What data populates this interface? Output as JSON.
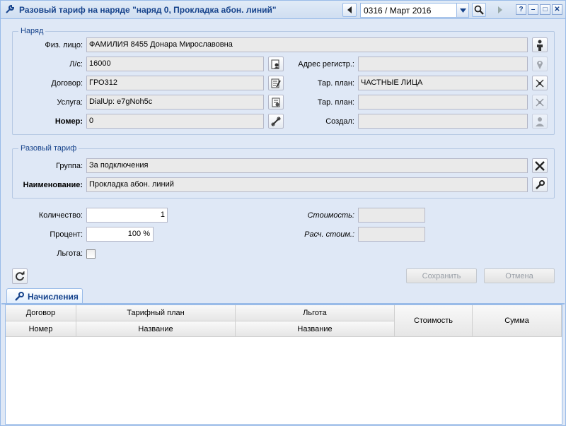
{
  "window": {
    "title": "Разовый тариф на наряде \"наряд 0, Прокладка абон. линий\"",
    "period": "0316 / Март 2016"
  },
  "naryad": {
    "legend": "Наряд",
    "fiz_lico": {
      "label": "Физ. лицо:",
      "value": "ФАМИЛИЯ 8455 Донара Мирославовна"
    },
    "ls": {
      "label": "Л/с:",
      "value": "16000"
    },
    "dogovor": {
      "label": "Договор:",
      "value": "ГРО312"
    },
    "usluga": {
      "label": "Услуга:",
      "value": "DialUp: e7gNoh5c"
    },
    "nomer": {
      "label": "Номер:",
      "value": "0"
    },
    "adres": {
      "label": "Адрес регистр.:",
      "value": ""
    },
    "tar_plan1": {
      "label": "Тар. план:",
      "value": "ЧАСТНЫЕ ЛИЦА"
    },
    "tar_plan2": {
      "label": "Тар. план:",
      "value": ""
    },
    "sozdal": {
      "label": "Создал:",
      "value": ""
    }
  },
  "razoviy": {
    "legend": "Разовый тариф",
    "gruppa": {
      "label": "Группа:",
      "value": "За подключения"
    },
    "naim": {
      "label": "Наименование:",
      "value": "Прокладка абон. линий"
    }
  },
  "extra": {
    "kolichestvo": {
      "label": "Количество:",
      "value": "1"
    },
    "procent": {
      "label": "Процент:",
      "value": "100 %"
    },
    "lgota": {
      "label": "Льгота:"
    },
    "stoimost": {
      "label": "Стоимость:",
      "value": ""
    },
    "rasch": {
      "label": "Расч. стоим.:",
      "value": ""
    }
  },
  "buttons": {
    "save": "Сохранить",
    "cancel": "Отмена"
  },
  "tab": {
    "label": "Начисления"
  },
  "grid": {
    "group_headers": [
      "Договор",
      "Тарифный план",
      "Льгота"
    ],
    "sub_headers": [
      "Номер",
      "Название",
      "Название"
    ],
    "headers": [
      "Стоимость",
      "Сумма"
    ],
    "rows": []
  },
  "colors": {
    "accent": "#15428b",
    "border": "#99bbe8",
    "panel": "#dfe8f6"
  }
}
